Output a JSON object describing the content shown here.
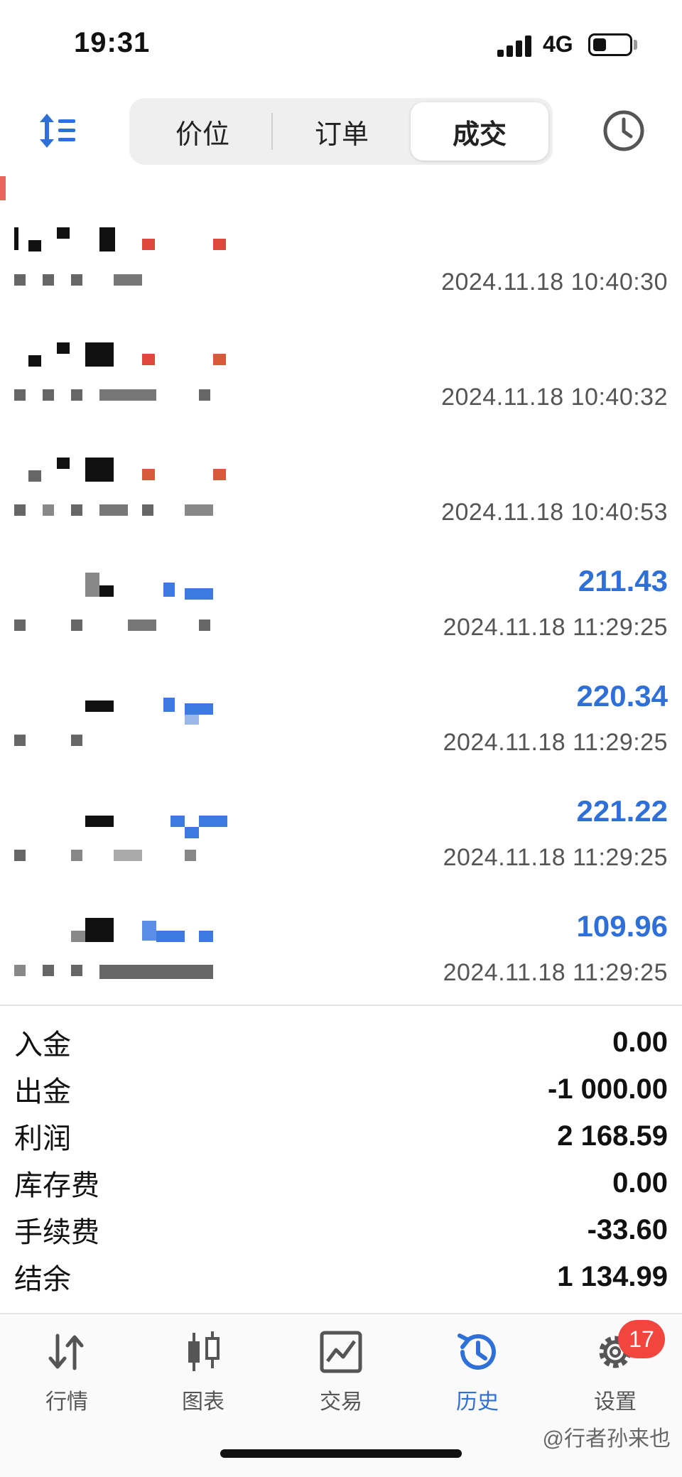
{
  "status_bar": {
    "time": "19:31",
    "network": "4G"
  },
  "toolbar": {
    "tabs": [
      {
        "label": "价位"
      },
      {
        "label": "订单"
      },
      {
        "label": "成交",
        "active": true
      }
    ],
    "icons": [
      "sort-icon",
      "clock-icon"
    ]
  },
  "deals": [
    {
      "profit": "",
      "time": "2024.11.18 10:40:30"
    },
    {
      "profit": "",
      "time": "2024.11.18 10:40:32"
    },
    {
      "profit": "",
      "time": "2024.11.18 10:40:53"
    },
    {
      "profit": "211.43",
      "time": "2024.11.18 11:29:25"
    },
    {
      "profit": "220.34",
      "time": "2024.11.18 11:29:25"
    },
    {
      "profit": "221.22",
      "time": "2024.11.18 11:29:25"
    },
    {
      "profit": "109.96",
      "time": "2024.11.18 11:29:25"
    }
  ],
  "summary": [
    {
      "label": "入金",
      "value": "0.00"
    },
    {
      "label": "出金",
      "value": "-1 000.00"
    },
    {
      "label": "利润",
      "value": "2 168.59"
    },
    {
      "label": "库存费",
      "value": "0.00"
    },
    {
      "label": "手续费",
      "value": "-33.60"
    },
    {
      "label": "结余",
      "value": "1 134.99"
    }
  ],
  "tabbar": {
    "items": [
      {
        "label": "行情",
        "icon": "quotes-icon"
      },
      {
        "label": "图表",
        "icon": "chart-icon"
      },
      {
        "label": "交易",
        "icon": "trade-icon"
      },
      {
        "label": "历史",
        "icon": "history-icon",
        "active": true
      },
      {
        "label": "设置",
        "icon": "settings-icon"
      }
    ],
    "badge": "17"
  },
  "watermark": "@行者孙来也",
  "colors": {
    "accent": "#2f6fd8",
    "badge": "#f2453d",
    "pixel_red": "#e0473d",
    "pixel_blue": "#3d7be0"
  }
}
